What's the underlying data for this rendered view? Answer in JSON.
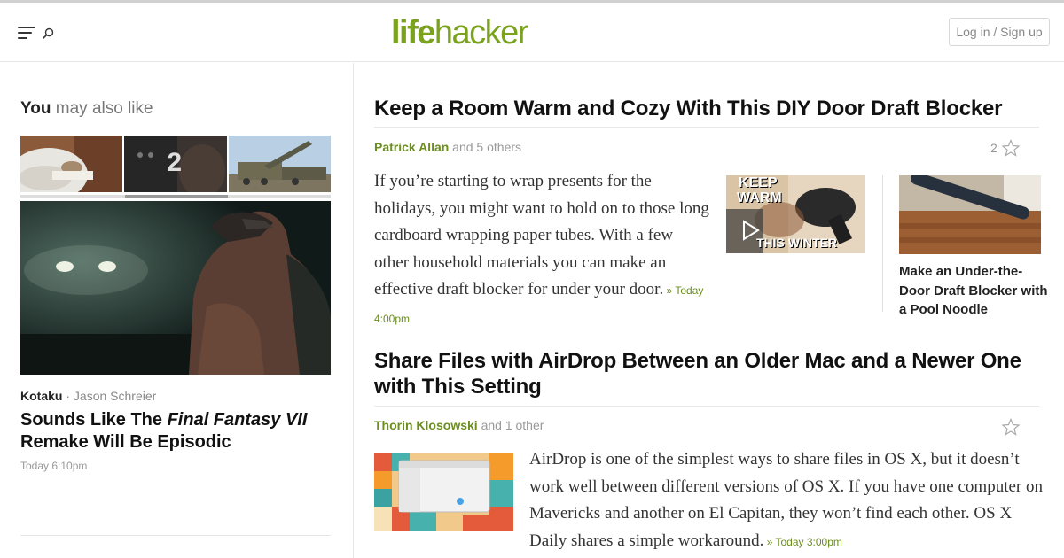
{
  "brand": {
    "logo_life": "life",
    "logo_hacker": "hacker",
    "accent_color": "#7aa21c"
  },
  "header": {
    "menu_icon": "hamburger-menu-icon",
    "search_icon": "search-icon",
    "login_label": "Log in / Sign up"
  },
  "sidebar": {
    "heading_strong": "You",
    "heading_light": "may also like",
    "carousel_badge": "2",
    "featured": {
      "source": "Kotaku",
      "separator": " · ",
      "author": "Jason Schreier",
      "headline_pre": "Sounds Like The ",
      "headline_em": "Final Fantasy VII",
      "headline_post": " Remake Will Be Episodic",
      "time": "Today 6:10pm"
    }
  },
  "articles": [
    {
      "title": "Keep a Room Warm and Cozy With This DIY Door Draft Blocker",
      "author": "Patrick Allan",
      "others": " and 5 others",
      "likes": "2",
      "excerpt": "If you’re starting to wrap presents for the holidays, you might want to hold on to those long cardboard wrapping paper tubes. With a few other household materials you can make an effective draft blocker for under your door.",
      "timestamp": " » Today 4:00pm",
      "video_text_top": "KEEP",
      "video_text_mid": "WARM",
      "video_text_bottom": "THIS WINTER",
      "related_title": "Make an Under-the-Door Draft Blocker with a Pool Noodle"
    },
    {
      "title": "Share Files with AirDrop Between an Older Mac and a Newer One with This Setting",
      "author": "Thorin Klosowski",
      "others": " and 1 other",
      "excerpt": "AirDrop is one of the simplest ways to share files in OS X, but it doesn’t work well between different versions of OS X. If you have one computer on Mavericks and another on El Capitan, they won’t find each other. OS X Daily shares a simple workaround.",
      "timestamp": " » Today 3:00pm"
    }
  ]
}
